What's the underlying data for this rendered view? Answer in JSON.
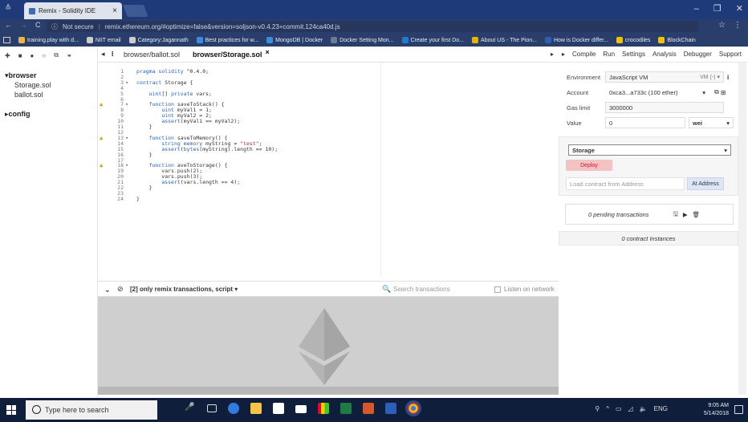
{
  "browser": {
    "tab_title": "Remix - Solidity IDE",
    "tab_close": "×",
    "nav_back": "←",
    "nav_forward": "→",
    "nav_reload": "C",
    "secure_label": "Not secure",
    "url": "remix.ethereum.org/#optimize=false&version=soljson-v0.4.23+commit.124ca40d.js",
    "win_min": "–",
    "win_max": "❐",
    "win_close": "✕",
    "star": "☆",
    "menu": "⋮",
    "bookmarks": [
      {
        "label": "training.play with d...",
        "color": "#f2b441"
      },
      {
        "label": "NIIT email",
        "color": "#ccc"
      },
      {
        "label": "Category:Jagannath",
        "color": "#ccc"
      },
      {
        "label": "Best practices for w...",
        "color": "#3c8de0"
      },
      {
        "label": "MongoDB | Docker",
        "color": "#3c8de0"
      },
      {
        "label": "Docker Setting Mon...",
        "color": "#6a7a90"
      },
      {
        "label": "Create your first Do...",
        "color": "#1d7ccf"
      },
      {
        "label": "About US - The Pion...",
        "color": "#e4b400"
      },
      {
        "label": "How is Docker differ...",
        "color": "#2e5fb0"
      },
      {
        "label": "crocodiles",
        "color": "#f2c200"
      },
      {
        "label": "BlockChain",
        "color": "#f2c200"
      }
    ]
  },
  "remix": {
    "file_explorer": {
      "folders": [
        {
          "name": "browser",
          "files": [
            "Storage.sol",
            "ballot.sol"
          ]
        },
        {
          "name": "config",
          "files": []
        }
      ]
    },
    "editor_tabs": [
      "browser/ballot.sol",
      "browser/Storage.sol"
    ],
    "active_tab_close": "×",
    "code_lines": [
      {
        "n": "1",
        "text": "pragma solidity ^0.4.0;"
      },
      {
        "n": "2",
        "text": ""
      },
      {
        "n": "3",
        "text": "contract Storage {",
        "fold": true
      },
      {
        "n": "4",
        "text": ""
      },
      {
        "n": "5",
        "text": "    uint[] private vars;"
      },
      {
        "n": "6",
        "text": ""
      },
      {
        "n": "7",
        "text": "    function saveToStack() {",
        "fold": true,
        "warn": true
      },
      {
        "n": "8",
        "text": "        uint myVal1 = 1;"
      },
      {
        "n": "9",
        "text": "        uint myVal2 = 2;"
      },
      {
        "n": "10",
        "text": "        assert(myVal1 == myVal2);"
      },
      {
        "n": "11",
        "text": "    }"
      },
      {
        "n": "12",
        "text": ""
      },
      {
        "n": "13",
        "text": "    function saveToMemory() {",
        "fold": true,
        "warn": true
      },
      {
        "n": "14",
        "text": "        string memory myString = \"test\";"
      },
      {
        "n": "15",
        "text": "        assert(bytes(myString).length == 10);"
      },
      {
        "n": "16",
        "text": "    }"
      },
      {
        "n": "17",
        "text": ""
      },
      {
        "n": "18",
        "text": "    function aveToStorage() {",
        "fold": true,
        "warn": true
      },
      {
        "n": "19",
        "text": "        vars.push(2);"
      },
      {
        "n": "20",
        "text": "        vars.push(3);"
      },
      {
        "n": "21",
        "text": "        assert(vars.length == 4);"
      },
      {
        "n": "22",
        "text": "    }"
      },
      {
        "n": "23",
        "text": ""
      },
      {
        "n": "24",
        "text": "}"
      }
    ],
    "terminal": {
      "filter_label": "[2] only remix transactions, script",
      "search_placeholder": "Search transactions",
      "listen_label": "Listen on network",
      "prompt": ">"
    },
    "right_tabs": [
      "Compile",
      "Run",
      "Settings",
      "Analysis",
      "Debugger",
      "Support"
    ],
    "run": {
      "environment_label": "Environment",
      "environment_value": "JavaScript VM",
      "environment_extra": "VM (-)",
      "account_label": "Account",
      "account_value": "0xca3...a733c (100 ether)",
      "gas_label": "Gas limit",
      "gas_value": "3000000",
      "value_label": "Value",
      "value_value": "0",
      "value_unit": "wei",
      "contract_select": "Storage",
      "deploy_label": "Deploy",
      "load_placeholder": "Load contract from Address",
      "at_address_label": "At Address",
      "pending_label": "0 pending transactions",
      "instances_label": "0 contract Instances"
    }
  },
  "taskbar": {
    "search_placeholder": "Type here to search",
    "time": "9:05 AM",
    "date": "5/14/2018",
    "lang": "ENG"
  }
}
